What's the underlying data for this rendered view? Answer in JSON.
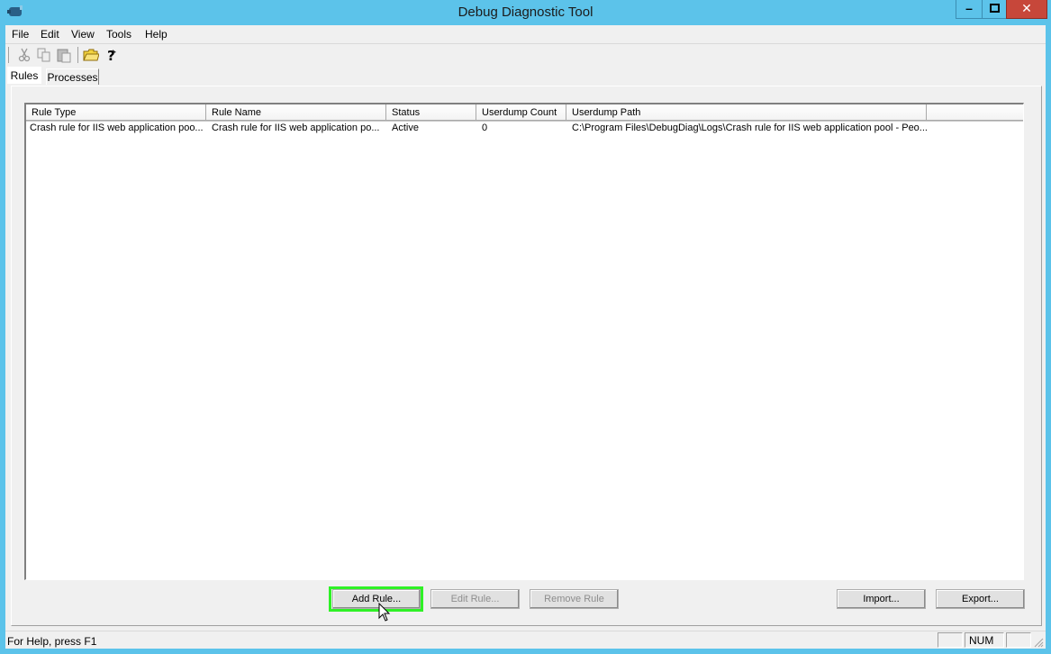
{
  "window": {
    "title": "Debug Diagnostic Tool"
  },
  "menu": [
    "File",
    "Edit",
    "View",
    "Tools",
    "Help"
  ],
  "toolbar": {
    "icons": [
      "cut-icon",
      "copy-icon",
      "paste-icon",
      "open-folder-icon",
      "help-icon"
    ]
  },
  "tabs": [
    {
      "label": "Rules",
      "active": true
    },
    {
      "label": "Processes",
      "active": false
    }
  ],
  "list": {
    "columns": [
      "Rule Type",
      "Rule Name",
      "Status",
      "Userdump Count",
      "Userdump Path"
    ],
    "rows": [
      {
        "rule_type": "Crash rule for IIS web application poo...",
        "rule_name": "Crash rule for IIS web application po...",
        "status": "Active",
        "userdump_count": "0",
        "userdump_path": "C:\\Program Files\\DebugDiag\\Logs\\Crash rule for IIS web application pool - Peo..."
      }
    ]
  },
  "buttons": {
    "add_rule": "Add Rule...",
    "edit_rule": "Edit Rule...",
    "remove_rule": "Remove Rule",
    "import": "Import...",
    "export": "Export..."
  },
  "statusbar": {
    "help_text": "For Help, press F1",
    "num": "NUM"
  },
  "colors": {
    "titlebar": "#5cc3ea",
    "close_button": "#c7473a",
    "highlight": "#2ff126"
  }
}
